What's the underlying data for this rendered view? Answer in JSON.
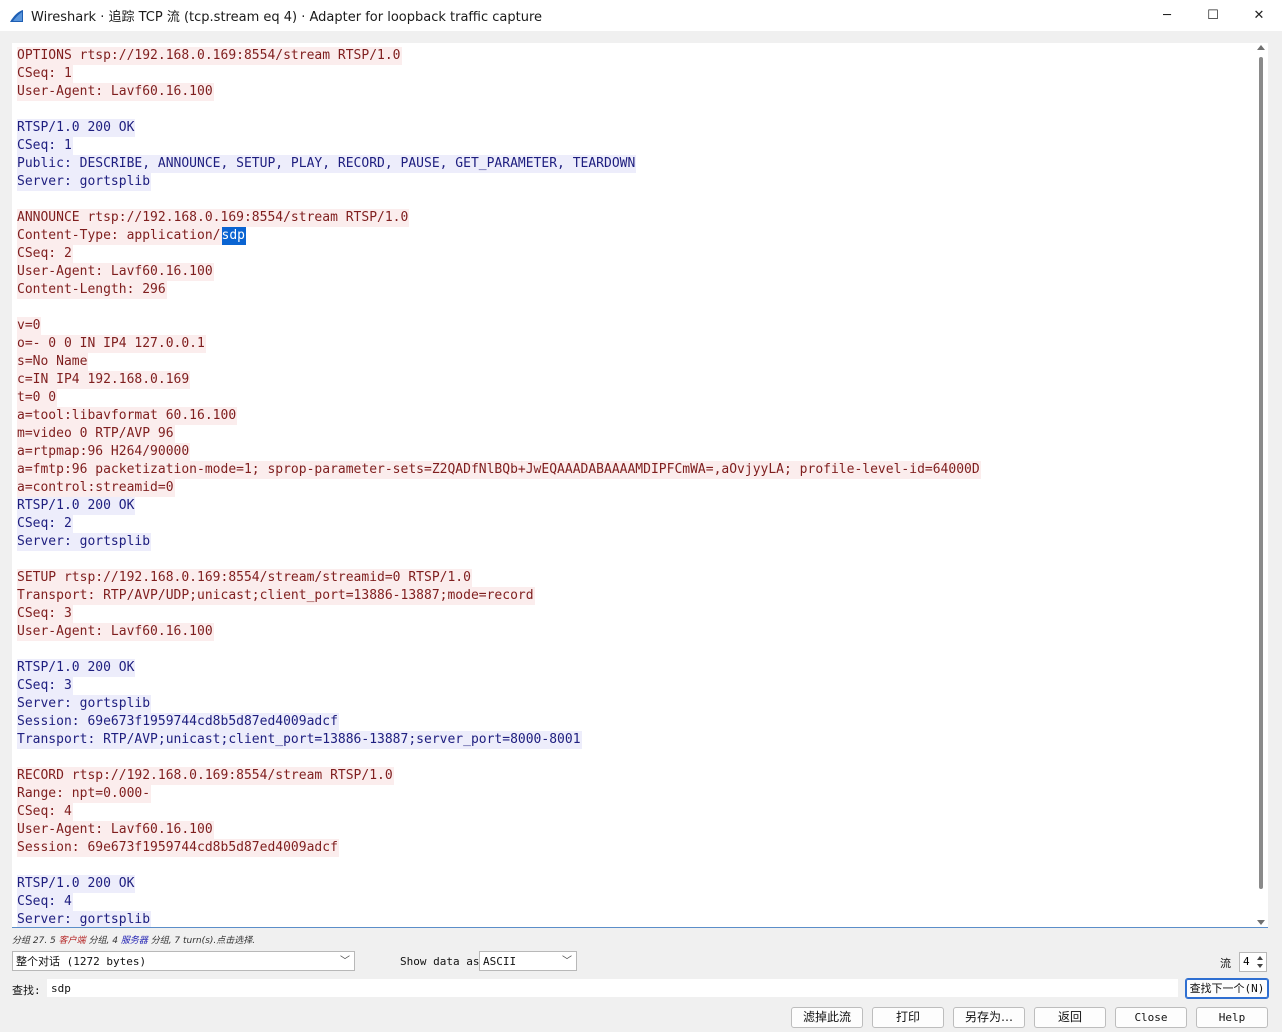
{
  "window": {
    "title": "Wireshark · 追踪 TCP 流 (tcp.stream eq 4) · Adapter for loopback traffic capture",
    "minimize": "─",
    "maximize": "☐",
    "close": "✕"
  },
  "stream": [
    {
      "d": "c",
      "t": "OPTIONS rtsp://192.168.0.169:8554/stream RTSP/1.0"
    },
    {
      "d": "c",
      "t": "CSeq: 1"
    },
    {
      "d": "c",
      "t": "User-Agent: Lavf60.16.100"
    },
    {
      "d": "",
      "t": ""
    },
    {
      "d": "s",
      "t": "RTSP/1.0 200 OK"
    },
    {
      "d": "s",
      "t": "CSeq: 1"
    },
    {
      "d": "s",
      "t": "Public: DESCRIBE, ANNOUNCE, SETUP, PLAY, RECORD, PAUSE, GET_PARAMETER, TEARDOWN"
    },
    {
      "d": "s",
      "t": "Server: gortsplib"
    },
    {
      "d": "",
      "t": ""
    },
    {
      "d": "c",
      "t": "ANNOUNCE rtsp://192.168.0.169:8554/stream RTSP/1.0"
    },
    {
      "d": "c",
      "t": "Content-Type: application/",
      "hl": "sdp"
    },
    {
      "d": "c",
      "t": "CSeq: 2"
    },
    {
      "d": "c",
      "t": "User-Agent: Lavf60.16.100"
    },
    {
      "d": "c",
      "t": "Content-Length: 296"
    },
    {
      "d": "",
      "t": ""
    },
    {
      "d": "c",
      "t": "v=0"
    },
    {
      "d": "c",
      "t": "o=- 0 0 IN IP4 127.0.0.1"
    },
    {
      "d": "c",
      "t": "s=No Name"
    },
    {
      "d": "c",
      "t": "c=IN IP4 192.168.0.169"
    },
    {
      "d": "c",
      "t": "t=0 0"
    },
    {
      "d": "c",
      "t": "a=tool:libavformat 60.16.100"
    },
    {
      "d": "c",
      "t": "m=video 0 RTP/AVP 96"
    },
    {
      "d": "c",
      "t": "a=rtpmap:96 H264/90000"
    },
    {
      "d": "c",
      "t": "a=fmtp:96 packetization-mode=1; sprop-parameter-sets=Z2QADfNlBQb+JwEQAAADABAAAAMDIPFCmWA=,aOvjyyLA; profile-level-id=64000D"
    },
    {
      "d": "c",
      "t": "a=control:streamid=0"
    },
    {
      "d": "s",
      "t": "RTSP/1.0 200 OK"
    },
    {
      "d": "s",
      "t": "CSeq: 2"
    },
    {
      "d": "s",
      "t": "Server: gortsplib"
    },
    {
      "d": "",
      "t": ""
    },
    {
      "d": "c",
      "t": "SETUP rtsp://192.168.0.169:8554/stream/streamid=0 RTSP/1.0"
    },
    {
      "d": "c",
      "t": "Transport: RTP/AVP/UDP;unicast;client_port=13886-13887;mode=record"
    },
    {
      "d": "c",
      "t": "CSeq: 3"
    },
    {
      "d": "c",
      "t": "User-Agent: Lavf60.16.100"
    },
    {
      "d": "",
      "t": ""
    },
    {
      "d": "s",
      "t": "RTSP/1.0 200 OK"
    },
    {
      "d": "s",
      "t": "CSeq: 3"
    },
    {
      "d": "s",
      "t": "Server: gortsplib"
    },
    {
      "d": "s",
      "t": "Session: 69e673f1959744cd8b5d87ed4009adcf"
    },
    {
      "d": "s",
      "t": "Transport: RTP/AVP;unicast;client_port=13886-13887;server_port=8000-8001"
    },
    {
      "d": "",
      "t": ""
    },
    {
      "d": "c",
      "t": "RECORD rtsp://192.168.0.169:8554/stream RTSP/1.0"
    },
    {
      "d": "c",
      "t": "Range: npt=0.000-"
    },
    {
      "d": "c",
      "t": "CSeq: 4"
    },
    {
      "d": "c",
      "t": "User-Agent: Lavf60.16.100"
    },
    {
      "d": "c",
      "t": "Session: 69e673f1959744cd8b5d87ed4009adcf"
    },
    {
      "d": "",
      "t": ""
    },
    {
      "d": "s",
      "t": "RTSP/1.0 200 OK"
    },
    {
      "d": "s",
      "t": "CSeq: 4"
    },
    {
      "d": "s",
      "t": "Server: gortsplib"
    }
  ],
  "status": {
    "prefix": "分组 27. 5 ",
    "client": "客户端",
    "middle": " 分组, 4 ",
    "server": "服务器",
    "suffix": " 分组, 7 turn(s).点击选择."
  },
  "controls": {
    "conversation_select": "整个对话 (1272 bytes)",
    "show_data_label": "Show data as",
    "show_data_select": "ASCII",
    "stream_label": "流",
    "stream_value": "4",
    "find_label": "查找:",
    "find_value": "sdp",
    "find_next": "查找下一个(N)"
  },
  "buttons": {
    "filter_out": "滤掉此流",
    "print": "打印",
    "save_as": "另存为…",
    "back": "返回",
    "close": "Close",
    "help": "Help"
  },
  "colors": {
    "client_text": "#7f1e1e",
    "client_bg": "#fbeded",
    "server_text": "#1e1e7f",
    "server_bg": "#ededfb",
    "highlight": "#0a64d2"
  }
}
